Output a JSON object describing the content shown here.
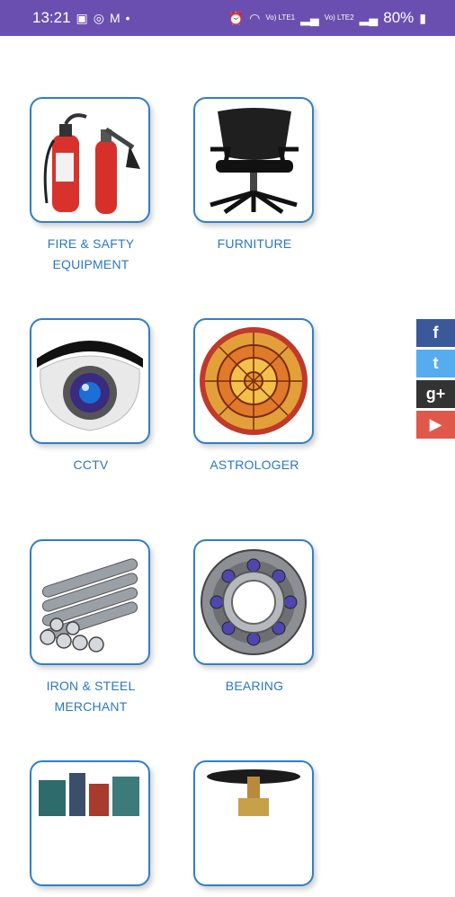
{
  "status_bar": {
    "time": "13:21",
    "battery": "80%",
    "network_labels": [
      "Vo) LTE1",
      "Vo) LTE2"
    ]
  },
  "categories": [
    {
      "label": "FIRE & SAFTY EQUIPMENT"
    },
    {
      "label": "FURNITURE"
    },
    {
      "label": "CCTV"
    },
    {
      "label": "ASTROLOGER"
    },
    {
      "label": "IRON & STEEL MERCHANT"
    },
    {
      "label": "BEARING"
    },
    {
      "label": ""
    },
    {
      "label": ""
    }
  ],
  "social": {
    "facebook": "f",
    "twitter": "t",
    "google_plus": "g+",
    "youtube": "▶",
    "colors": {
      "facebook": "#3b5998",
      "twitter": "#55acee",
      "google_plus": "#333333",
      "youtube": "#e0584a"
    }
  },
  "accent_color": "#2a78c2",
  "status_bar_color": "#6a4fb0"
}
